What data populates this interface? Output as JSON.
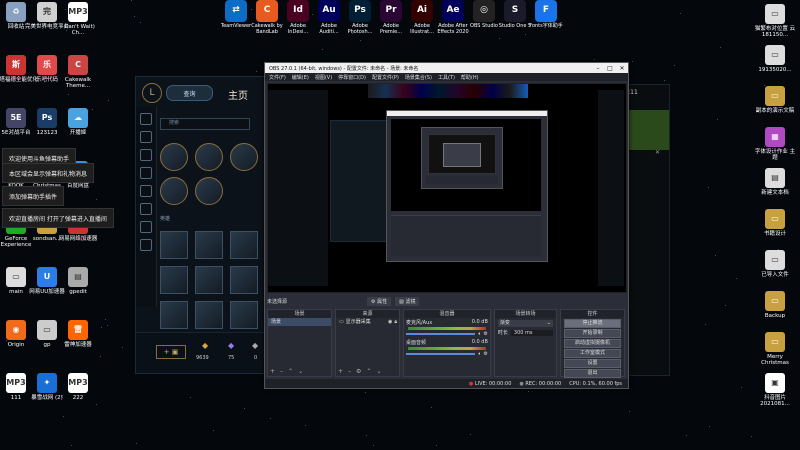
{
  "desktop": {
    "left_icons": [
      {
        "label": "回收站",
        "icon": "recycle-bin-icon",
        "color": "#8aa0c0",
        "glyph": "♻"
      },
      {
        "label": "完美世界电竞平台",
        "icon": "perfect-world-icon",
        "color": "#d0d0d0",
        "glyph": "完"
      },
      {
        "label": "I Can't Wait) Ch...",
        "icon": "mp3-file-icon",
        "color": "#ffffff",
        "glyph": "MP3"
      },
      {
        "label": "斯塔福德全能优化",
        "icon": "optimizer-icon",
        "color": "#c33",
        "glyph": "斯"
      },
      {
        "label": "乐吧代码",
        "icon": "lebar-icon",
        "color": "#e04a4a",
        "glyph": "乐"
      },
      {
        "label": "Cakewalk Theme...",
        "icon": "cakewalk-theme-icon",
        "color": "#c44",
        "glyph": "C"
      },
      {
        "label": "5E对战平台",
        "icon": "5e-icon",
        "color": "#446",
        "glyph": "5E"
      },
      {
        "label": "123123",
        "icon": "photoshop-file-icon",
        "color": "#1a3c66",
        "glyph": "Ps"
      },
      {
        "label": "开播姬",
        "icon": "bilibili-icon",
        "color": "#4aa3e0",
        "glyph": "☁"
      },
      {
        "label": "KOOK",
        "icon": "kook-icon",
        "color": "#222",
        "glyph": "K"
      },
      {
        "label": "Christmas",
        "icon": "photoshop-file-2-icon",
        "color": "#1a3c66",
        "glyph": "Ps"
      },
      {
        "label": "百度网盘",
        "icon": "baidu-netdisk-icon",
        "color": "#3a8ee6",
        "glyph": "◕"
      },
      {
        "label": "GeForce Experience",
        "icon": "geforce-icon",
        "color": "#2a2",
        "glyph": "▶"
      },
      {
        "label": "sondsan...",
        "icon": "folder-icon",
        "color": "#c8a040",
        "glyph": "▭"
      },
      {
        "label": "网易网络加速器",
        "icon": "netease-icon",
        "color": "#c33",
        "glyph": "网"
      },
      {
        "label": "main",
        "icon": "main-file-icon",
        "color": "#ddd",
        "glyph": "▭"
      },
      {
        "label": "网易UU加速器",
        "icon": "uu-icon",
        "color": "#2b7de9",
        "glyph": "U"
      },
      {
        "label": "gpedit",
        "icon": "gpedit-icon",
        "color": "#aaa",
        "glyph": "▤"
      },
      {
        "label": "Origin",
        "icon": "origin-icon",
        "color": "#f06a1a",
        "glyph": "◉"
      },
      {
        "label": "gp",
        "icon": "gp-icon",
        "color": "#ccc",
        "glyph": "▭"
      },
      {
        "label": "雷神加速器",
        "icon": "leishen-icon",
        "color": "#f60",
        "glyph": "雷"
      },
      {
        "label": "111",
        "icon": "mp3-file-2-icon",
        "color": "#fff",
        "glyph": "MP3"
      },
      {
        "label": "暴雪战网 (2)",
        "icon": "battlenet-icon",
        "color": "#1a6fd6",
        "glyph": "✦"
      },
      {
        "label": "222",
        "icon": "mp3-file-3-icon",
        "color": "#fff",
        "glyph": "MP3"
      }
    ],
    "top_icons": [
      {
        "label": "TeamViewer",
        "icon": "teamviewer-icon",
        "color": "#0e6cc4",
        "glyph": "⇄"
      },
      {
        "label": "Cakewalk by BandLab",
        "icon": "cakewalk-icon",
        "color": "#e85a1e",
        "glyph": "C"
      },
      {
        "label": "Adobe InDesi...",
        "icon": "indesign-icon",
        "color": "#49021f",
        "glyph": "Id"
      },
      {
        "label": "Adobe Auditi...",
        "icon": "audition-icon",
        "color": "#00005b",
        "glyph": "Au"
      },
      {
        "label": "Adobe Photosh...",
        "icon": "photoshop-icon",
        "color": "#001e36",
        "glyph": "Ps"
      },
      {
        "label": "Adobe Premie...",
        "icon": "premiere-icon",
        "color": "#2a0634",
        "glyph": "Pr"
      },
      {
        "label": "Adobe Illustrat...",
        "icon": "illustrator-icon",
        "color": "#330000",
        "glyph": "Ai"
      },
      {
        "label": "Adobe After Effects 2020",
        "icon": "after-effects-icon",
        "color": "#00005b",
        "glyph": "Ae"
      },
      {
        "label": "OBS Studio",
        "icon": "obs-icon",
        "color": "#222",
        "glyph": "◎"
      },
      {
        "label": "Studio One 5",
        "icon": "studio-one-icon",
        "color": "#1a1a2a",
        "glyph": "S"
      },
      {
        "label": "Fonts字体助手",
        "icon": "fonts-icon",
        "color": "#1a73e8",
        "glyph": "F"
      }
    ],
    "right_icons": [
      {
        "label": "猫繁布对位置 云 181150...",
        "icon": "doc-icon",
        "color": "#ddd",
        "glyph": "▭"
      },
      {
        "label": "19135020...",
        "icon": "doc-2-icon",
        "color": "#ddd",
        "glyph": "▭"
      },
      {
        "label": "副本的演示文稿",
        "icon": "ppt-icon",
        "color": "#c8a040",
        "glyph": "▭"
      },
      {
        "label": "字体设计作业 主题",
        "icon": "rar-icon",
        "color": "#b04ac0",
        "glyph": "▦"
      },
      {
        "label": "新建文本档",
        "icon": "txt-icon",
        "color": "#ddd",
        "glyph": "▤"
      },
      {
        "label": "书籍设计",
        "icon": "book-icon",
        "color": "#c8a040",
        "glyph": "▭"
      },
      {
        "label": "已导入文件",
        "icon": "imported-icon",
        "color": "#ddd",
        "glyph": "▭"
      },
      {
        "label": "Backup",
        "icon": "backup-icon",
        "color": "#c8a040",
        "glyph": "▭"
      },
      {
        "label": "Merry Christmas",
        "icon": "christmas-icon",
        "color": "#c8a040",
        "glyph": "▭"
      },
      {
        "label": "抖音图片 2021081...",
        "icon": "image-icon",
        "color": "#fff",
        "glyph": "▣"
      }
    ]
  },
  "notifications": [
    "欢迎使用斗鱼弹幕助手",
    "本区域会显示弹幕和礼物消息",
    "添加弹幕助手插件",
    "欢迎直播房间 打开了弹幕进入直播间"
  ],
  "lol_client": {
    "play_label": "查询",
    "home_label": "主页",
    "search_placeholder": "搜索",
    "section_label": "英雄",
    "stats": [
      "9639",
      "75",
      "0"
    ]
  },
  "obs": {
    "title": "OBS 27.0.1 (64-bit, windows) - 配置文件: 未命名 - 场景: 未命名",
    "menus": [
      "文件(F)",
      "编辑(E)",
      "视图(V)",
      "停靠窗口(D)",
      "配置文件(P)",
      "场景集合(S)",
      "工具(T)",
      "帮助(H)"
    ],
    "no_source_label": "未选择源",
    "properties_label": "属性",
    "filters_label": "滤镜",
    "panels": {
      "scenes": {
        "title": "场景",
        "items": [
          "场景"
        ]
      },
      "sources": {
        "title": "来源",
        "items": [
          "显示器采集"
        ]
      },
      "mixer": {
        "title": "混音器",
        "tracks": [
          {
            "name": "麦克风/Aux",
            "db": "0.0 dB"
          },
          {
            "name": "桌面音频",
            "db": "0.0 dB"
          }
        ]
      },
      "transitions": {
        "title": "场景转场",
        "type": "渐变",
        "duration_label": "时长",
        "duration": "300 ms"
      },
      "controls": {
        "title": "控件",
        "buttons": [
          "停止推流",
          "开始录制",
          "启动虚拟摄像机",
          "工作室模式",
          "设置",
          "退出"
        ]
      }
    },
    "status": {
      "live": "LIVE: 00:00:00",
      "rec": "REC: 00:00:00",
      "cpu": "CPU: 0.1%, 60.00 fps"
    }
  },
  "right_window_tag": "ok11"
}
